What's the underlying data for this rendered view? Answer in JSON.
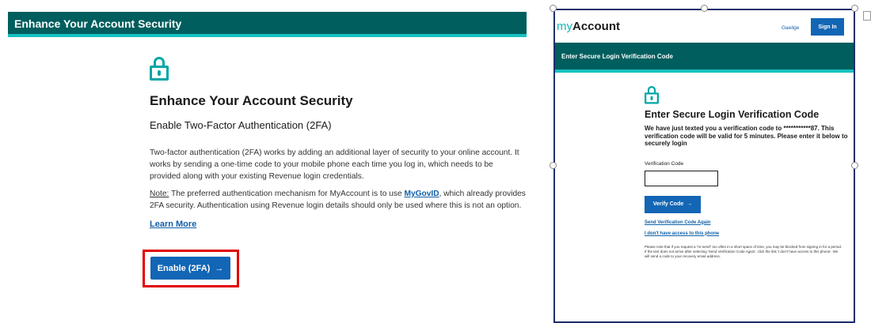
{
  "left": {
    "header_title": "Enhance Your Account Security",
    "lock_icon": "lock-icon",
    "title": "Enhance Your Account Security",
    "subtitle": "Enable Two-Factor Authentication (2FA)",
    "para1": "Two-factor authentication (2FA) works by adding an additional layer of security to your online account. It works by sending a one-time code to your mobile phone each time you log in, which needs to be provided along with your existing Revenue login credentials.",
    "note_label": "Note:",
    "note_text_before": " The preferred authentication mechanism for MyAccount is to use ",
    "note_link": "MyGovID",
    "note_text_after": ", which already provides 2FA security. Authentication using Revenue login details should only be used where this is not an option.",
    "learn_more": "Learn More",
    "enable_button": "Enable (2FA)",
    "arrow": "→",
    "highlight_color": "#e10000"
  },
  "right": {
    "logo_my": "my",
    "logo_account": "Account",
    "language_link": "Gaeilge",
    "sign_in": "Sign In",
    "header_title": "Enter Secure Login Verification Code",
    "title": "Enter Secure Login Verification Code",
    "body": "We have just texted you a verification code to ***********87. This verification code will be valid for 5 minutes. Please enter it below to securely login",
    "field_label": "Verification Code",
    "verify_button": "Verify Code",
    "arrow": "→",
    "resend_link": "Send Verification Code Again",
    "no_access_link": "I don't have access to this phone",
    "note": "Please note that if you request a \"re-send\" too often in a short space of time, you may be blocked from signing in for a period. If the text does not arrive after selecting 'Send Verification Code Again', click the link 'I don't have access to this phone'. We will send a code to your recovery email address."
  },
  "colors": {
    "header_teal": "#005e5e",
    "accent_cyan": "#17c1c1",
    "button_blue": "#1266b5",
    "link_blue": "#1060a8"
  }
}
